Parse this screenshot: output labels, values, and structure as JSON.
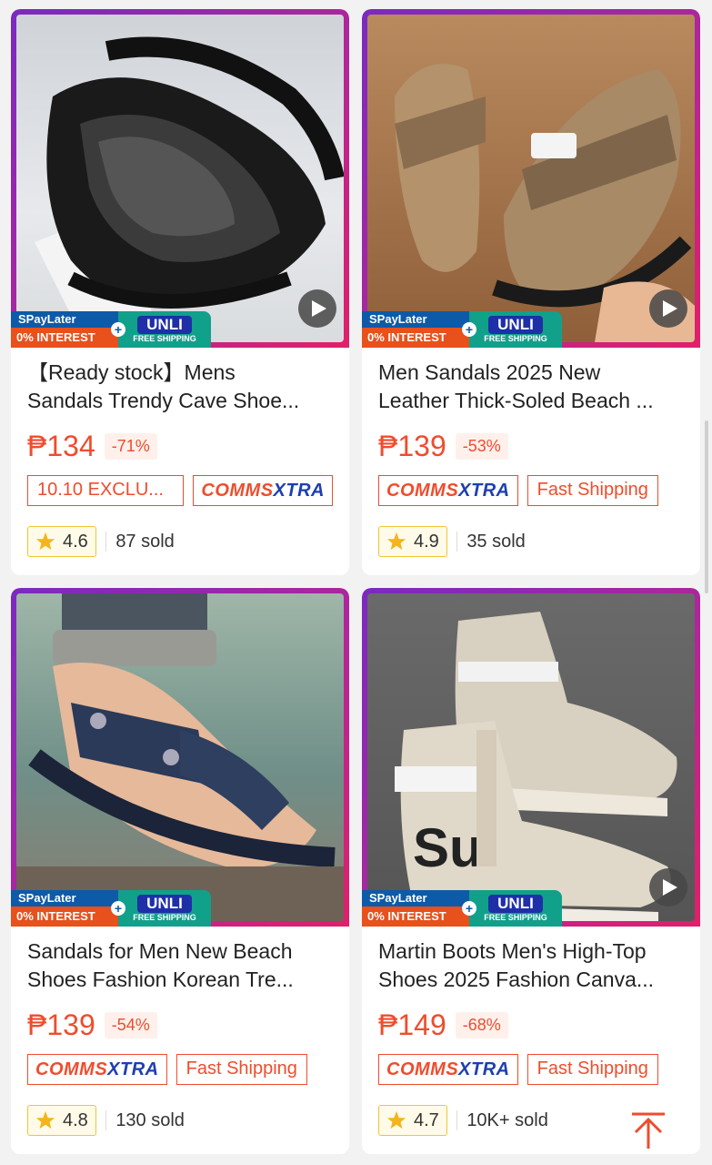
{
  "colors": {
    "accent": "#ee4d2d",
    "comms_blue": "#1d3fb0",
    "star": "#f3b51b"
  },
  "promo": {
    "spay_top": "SPayLater",
    "spay_bottom": "0% INTEREST",
    "unli_big": "UNLI",
    "unli_small": "FREE SHIPPING"
  },
  "products": [
    {
      "title_line1": "【Ready stock】Mens",
      "title_line2": "Sandals Trendy Cave Shoe...",
      "price": "₱134",
      "discount": "-71%",
      "tag_a": "10.10 EXCLU...",
      "tag_b_1": "COMMS",
      "tag_b_2": "XTRA",
      "rating": "4.6",
      "sold": "87 sold",
      "has_video": true
    },
    {
      "title_line1": "Men Sandals 2025 New",
      "title_line2": "Leather Thick-Soled Beach ...",
      "price": "₱139",
      "discount": "-53%",
      "tag_a_1": "COMMS",
      "tag_a_2": "XTRA",
      "tag_b": "Fast Shipping",
      "rating": "4.9",
      "sold": "35 sold",
      "has_video": true
    },
    {
      "title_line1": "Sandals for Men New Beach",
      "title_line2": "Shoes Fashion Korean Tre...",
      "price": "₱139",
      "discount": "-54%",
      "tag_a_1": "COMMS",
      "tag_a_2": "XTRA",
      "tag_b": "Fast Shipping",
      "rating": "4.8",
      "sold": "130 sold",
      "has_video": false
    },
    {
      "title_line1": "Martin Boots Men's High-Top",
      "title_line2": "Shoes 2025 Fashion Canva...",
      "price": "₱149",
      "discount": "-68%",
      "tag_a_1": "COMMS",
      "tag_a_2": "XTRA",
      "tag_b": "Fast Shipping",
      "rating": "4.7",
      "sold": "10K+ sold",
      "has_video": true
    }
  ]
}
